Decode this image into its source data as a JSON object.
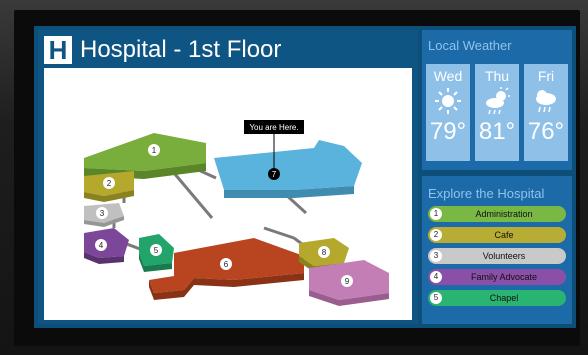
{
  "header": {
    "logo_letter": "H",
    "title": "Hospital - 1st Floor"
  },
  "map": {
    "you_are_here": "You are Here.",
    "rooms": [
      {
        "number": "1",
        "color": "#7aae3c"
      },
      {
        "number": "2",
        "color": "#b4a92c"
      },
      {
        "number": "3",
        "color": "#b9b9b9"
      },
      {
        "number": "4",
        "color": "#7c4798"
      },
      {
        "number": "5",
        "color": "#22a46a"
      },
      {
        "number": "6",
        "color": "#b8451f"
      },
      {
        "number": "7",
        "color": "#5ab3dc"
      },
      {
        "number": "8",
        "color": "#b4a92c"
      },
      {
        "number": "9",
        "color": "#c47eb6"
      }
    ]
  },
  "weather": {
    "title": "Local Weather",
    "days": [
      {
        "name": "Wed",
        "icon": "sun-icon",
        "temp": "79°"
      },
      {
        "name": "Thu",
        "icon": "partly-sunny-rain-icon",
        "temp": "81°"
      },
      {
        "name": "Fri",
        "icon": "cloud-rain-icon",
        "temp": "76°"
      }
    ]
  },
  "explore": {
    "title": "Explore the Hospital",
    "items": [
      {
        "number": "1",
        "label": "Administration",
        "color": "#7ab845"
      },
      {
        "number": "2",
        "label": "Cafe",
        "color": "#b7ad35"
      },
      {
        "number": "3",
        "label": "Volunteers",
        "color": "#c9c9c9"
      },
      {
        "number": "4",
        "label": "Family Advocate",
        "color": "#8a4fa6"
      },
      {
        "number": "5",
        "label": "Chapel",
        "color": "#2ab472"
      }
    ]
  }
}
